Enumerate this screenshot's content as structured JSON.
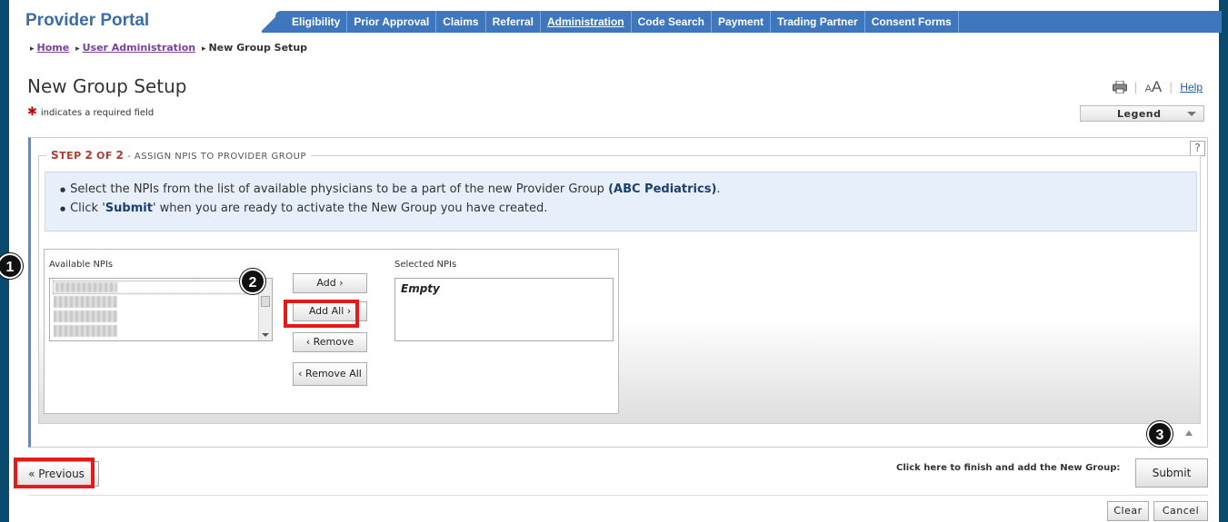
{
  "header": {
    "portal_title": "Provider Portal",
    "nav": [
      "Eligibility",
      "Prior Approval",
      "Claims",
      "Referral",
      "Administration",
      "Code Search",
      "Payment",
      "Trading Partner",
      "Consent Forms"
    ],
    "active_nav": "Administration"
  },
  "breadcrumb": {
    "home": "Home",
    "user_admin": "User Administration",
    "current": "New Group Setup"
  },
  "page": {
    "title": "New Group Setup",
    "required_note": "indicates a required field",
    "required_star": "✱",
    "font_small": "A",
    "font_big": "A",
    "help": "Help",
    "legend": "Legend",
    "help_qmark": "?"
  },
  "step": {
    "legend_step": "S",
    "legend_tep": "TEP",
    "legend_2": "2",
    "legend_of": "OF",
    "legend_2b": "2",
    "legend_rest": " - ASSIGN NPIS TO PROVIDER GROUP",
    "info_line1_pre": "Select the NPIs from the list of available physicians to be a part of the new Provider Group ",
    "info_line1_bold": "(ABC Pediatrics)",
    "info_line1_post": ".",
    "info_line2_pre": "Click '",
    "info_line2_bold": "Submit",
    "info_line2_post": "' when you are ready to activate the New Group you have created."
  },
  "npi": {
    "available_label": "Available NPIs",
    "selected_label": "Selected NPIs",
    "selected_empty": "Empty",
    "add": "Add ›",
    "add_all": "Add All ›",
    "remove": "‹ Remove",
    "remove_all": "‹ Remove All"
  },
  "footer": {
    "previous": "« Previous",
    "finish_label": "Click here to finish and add the New Group:",
    "submit": "Submit",
    "clear": "Clear",
    "cancel": "Cancel"
  },
  "annotations": {
    "m1": "1",
    "m2": "2",
    "m3": "3",
    "highlight_color": "#e31b1b"
  },
  "colors": {
    "nav_bg": "#3f77be",
    "frame": "#0a4a6e",
    "title": "#3a6da8"
  }
}
